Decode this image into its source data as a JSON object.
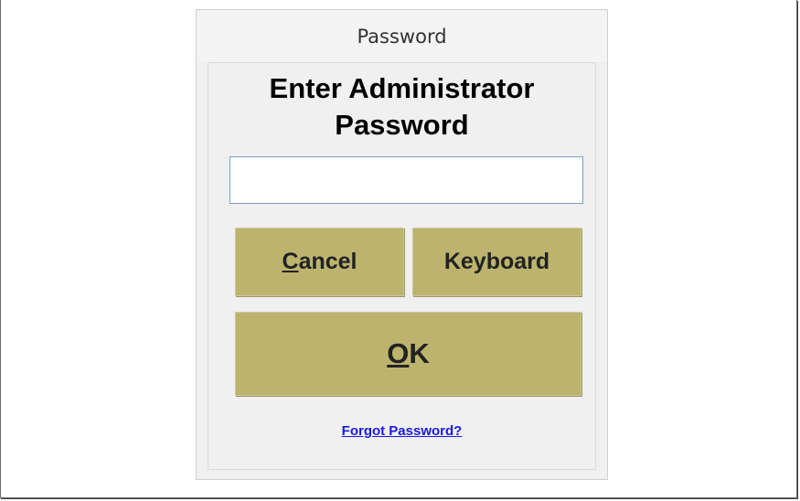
{
  "dialog": {
    "title": "Password",
    "heading_line1": "Enter Administrator",
    "heading_line2": "Password",
    "password_value": "",
    "cancel_mnemonic": "C",
    "cancel_rest": "ancel",
    "keyboard_label": "Keyboard",
    "ok_mnemonic": "O",
    "ok_rest": "K",
    "forgot_link": "Forgot Password?"
  },
  "colors": {
    "button_bg": "#bcb46e",
    "link": "#1a1ae6",
    "dialog_bg": "#f0f0f0"
  }
}
